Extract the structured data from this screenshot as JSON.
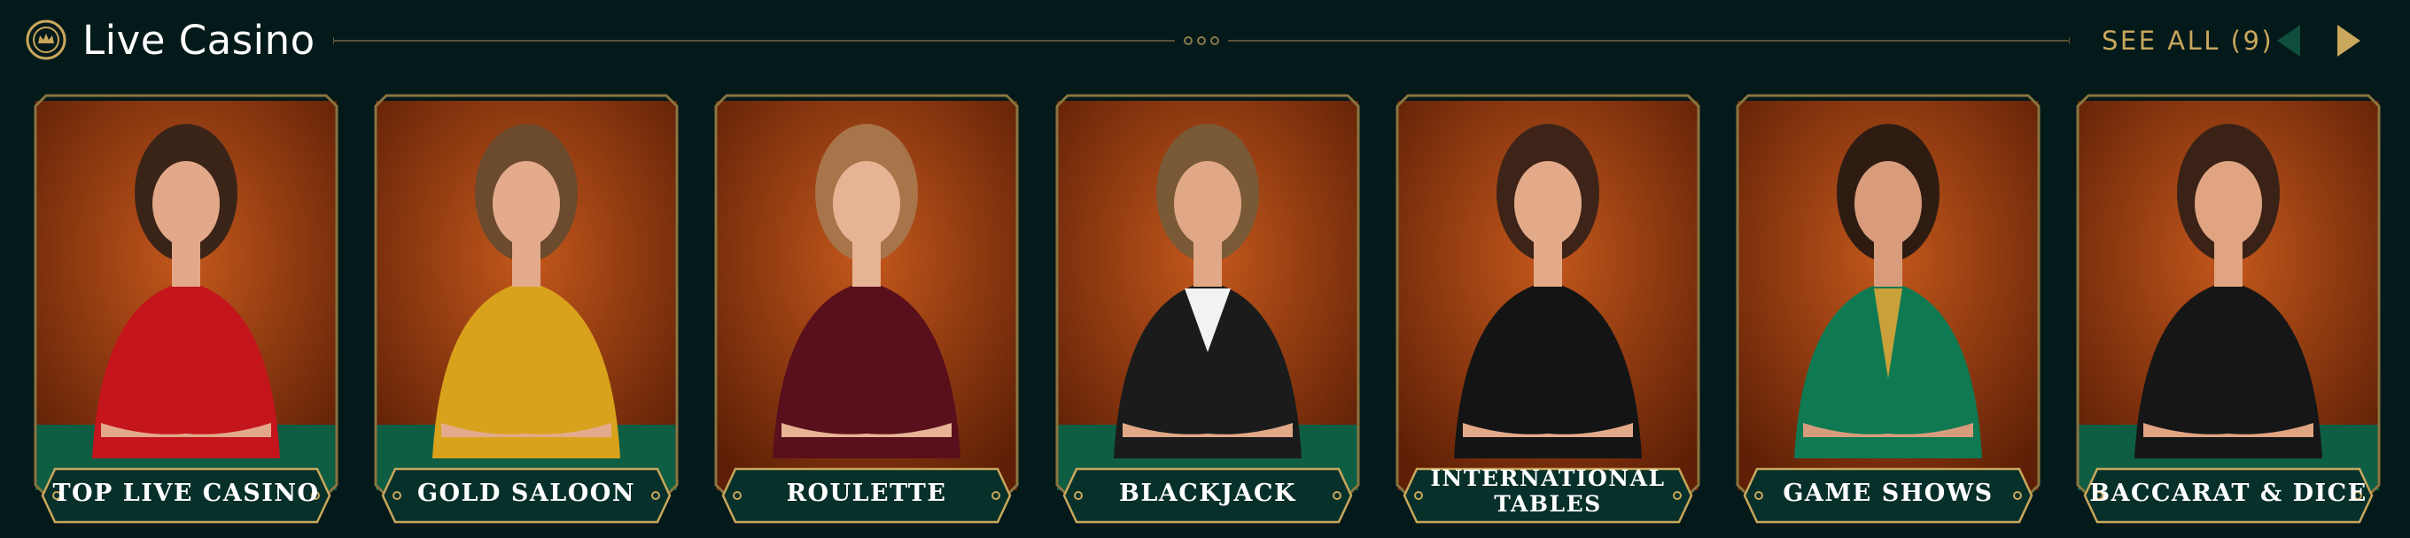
{
  "header": {
    "title": "Live Casino",
    "see_all": "SEE ALL (9)"
  },
  "colors": {
    "background": "#04191a",
    "gold": "#c9a75c",
    "card_bg": "#9c3e0c",
    "label_bg": "#08302a",
    "felt_green": "#0e5e44"
  },
  "icons": {
    "logo": "crown-coin-icon",
    "prev": "chevron-left-icon",
    "next": "chevron-right-icon"
  },
  "cards": [
    {
      "label_lines": [
        "TOP LIVE CASINO"
      ],
      "dealer": "Dealer in red lace dress at baccarat table"
    },
    {
      "label_lines": [
        "GOLD SALOON"
      ],
      "dealer": "Dealer in gold satin dress"
    },
    {
      "label_lines": [
        "ROULETTE"
      ],
      "dealer": "Dealer in burgundy dress at roulette wheel"
    },
    {
      "label_lines": [
        "BLACKJACK"
      ],
      "dealer": "Dealer in black vest and bow tie"
    },
    {
      "label_lines": [
        "INTERNATIONAL",
        "TABLES"
      ],
      "dealer": "Dealer in black dress holding chips"
    },
    {
      "label_lines": [
        "GAME SHOWS"
      ],
      "dealer": "Host in green suit with microphone"
    },
    {
      "label_lines": [
        "BACCARAT & DICE"
      ],
      "dealer": "Dealer in black dress at table"
    }
  ]
}
